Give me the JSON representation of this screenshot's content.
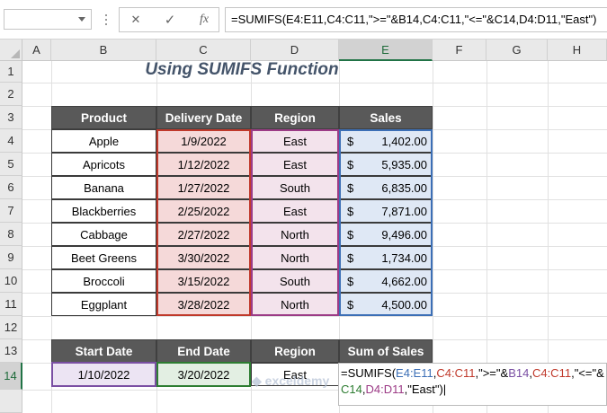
{
  "formula_bar": {
    "name_box": "",
    "cancel_icon": "✕",
    "enter_icon": "✓",
    "fx_label": "fx",
    "formula": "=SUMIFS(E4:E11,C4:C11,\">=\"&B14,C4:C11,\"<=\"&C14,D4:D11,\"East\")"
  },
  "columns": [
    "A",
    "B",
    "C",
    "D",
    "E",
    "F",
    "G",
    "H"
  ],
  "rows": [
    "1",
    "2",
    "3",
    "4",
    "5",
    "6",
    "7",
    "8",
    "9",
    "10",
    "11",
    "12",
    "13",
    "14"
  ],
  "title": "Using SUMIFS Function",
  "table": {
    "headers": [
      "Product",
      "Delivery Date",
      "Region",
      "Sales"
    ],
    "rows": [
      {
        "product": "Apple",
        "date": "1/9/2022",
        "region": "East",
        "cur": "$",
        "sales": "1,402.00"
      },
      {
        "product": "Apricots",
        "date": "1/12/2022",
        "region": "East",
        "cur": "$",
        "sales": "5,935.00"
      },
      {
        "product": "Banana",
        "date": "1/27/2022",
        "region": "South",
        "cur": "$",
        "sales": "6,835.00"
      },
      {
        "product": "Blackberries",
        "date": "2/25/2022",
        "region": "East",
        "cur": "$",
        "sales": "7,871.00"
      },
      {
        "product": "Cabbage",
        "date": "2/27/2022",
        "region": "North",
        "cur": "$",
        "sales": "9,496.00"
      },
      {
        "product": "Beet Greens",
        "date": "3/30/2022",
        "region": "North",
        "cur": "$",
        "sales": "1,734.00"
      },
      {
        "product": "Broccoli",
        "date": "3/15/2022",
        "region": "South",
        "cur": "$",
        "sales": "4,662.00"
      },
      {
        "product": "Eggplant",
        "date": "3/28/2022",
        "region": "North",
        "cur": "$",
        "sales": "4,500.00"
      }
    ]
  },
  "criteria": {
    "headers": [
      "Start Date",
      "End Date",
      "Region",
      "Sum of Sales"
    ],
    "start": "1/10/2022",
    "end": "3/20/2022",
    "region": "East"
  },
  "editor": {
    "line1": [
      {
        "t": "=SUMIFS(",
        "c": "#000000"
      },
      {
        "t": "E4:E11",
        "c": "#3c6fb6"
      },
      {
        "t": ",",
        "c": "#000000"
      },
      {
        "t": "C4:C11",
        "c": "#c0392b"
      },
      {
        "t": ",\">=\"&",
        "c": "#000000"
      },
      {
        "t": "B14",
        "c": "#7a4fa3"
      },
      {
        "t": ",",
        "c": "#000000"
      },
      {
        "t": "C4:C11",
        "c": "#c0392b"
      },
      {
        "t": ",\"<=\"&",
        "c": "#000000"
      }
    ],
    "line2": [
      {
        "t": "C14",
        "c": "#2e7d32"
      },
      {
        "t": ",",
        "c": "#000000"
      },
      {
        "t": "D4:D11",
        "c": "#9c3b86"
      },
      {
        "t": ",\"East\")",
        "c": "#000000"
      }
    ]
  },
  "watermark": "exceldemy",
  "colors": {
    "header_bg": "#595959",
    "date_range": "#c0392b",
    "region_range": "#9c3b86",
    "sales_range": "#3c6fb6",
    "start_ref": "#7a4fa3",
    "end_ref": "#2e7d32",
    "excel_green": "#217346"
  }
}
